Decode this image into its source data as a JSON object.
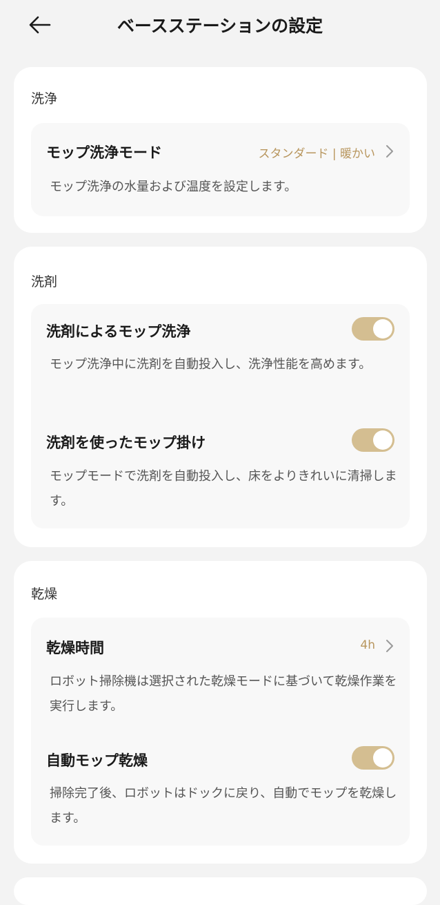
{
  "header": {
    "title": "ベースステーションの設定"
  },
  "sections": {
    "washing": {
      "label": "洗浄",
      "mop_wash_mode": {
        "title": "モップ洗浄モード",
        "value": "スタンダード | 暖かい",
        "description": "モップ洗浄の水量および温度を設定します。"
      }
    },
    "detergent": {
      "label": "洗剤",
      "detergent_mop_wash": {
        "title": "洗剤によるモップ洗浄",
        "enabled": true,
        "description": "モップ洗浄中に洗剤を自動投入し、洗浄性能を高めます。"
      },
      "detergent_mopping": {
        "title": "洗剤を使ったモップ掛け",
        "enabled": true,
        "description": "モップモードで洗剤を自動投入し、床をよりきれいに清掃します。"
      }
    },
    "drying": {
      "label": "乾燥",
      "drying_time": {
        "title": "乾燥時間",
        "value": "4h",
        "description": "ロボット掃除機は選択された乾燥モードに基づいて乾燥作業を実行します。"
      },
      "auto_mop_drying": {
        "title": "自動モップ乾燥",
        "enabled": true,
        "description": "掃除完了後、ロボットはドックに戻り、自動でモップを乾燥します。"
      }
    }
  },
  "colors": {
    "accent": "#b8965e",
    "toggle_on": "#d4be91",
    "background": "#f3f3f3",
    "card": "#ffffff",
    "inner_card": "#f8f8f8"
  }
}
